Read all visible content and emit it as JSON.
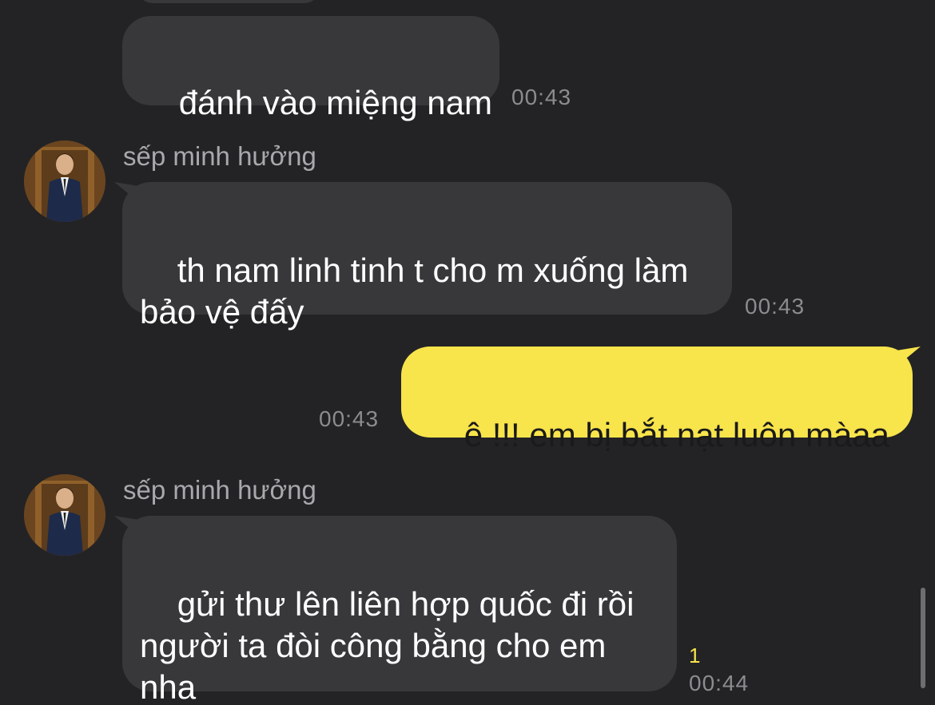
{
  "messages": [
    {
      "text": "đánh vào miệng nam",
      "time": "00:43"
    },
    {
      "sender": "sếp minh hưởng",
      "text": "th nam linh tinh t cho m xuống làm\nbảo vệ đấy",
      "time": "00:43"
    },
    {
      "text": "ê !!! em bị bắt nạt luôn màaa",
      "time": "00:43",
      "mine": true
    },
    {
      "sender": "sếp minh hưởng",
      "text": "gửi thư lên liên hợp quốc đi rồi\nngười ta đòi công bằng cho em\nnha",
      "time": "00:44",
      "unread": "1"
    }
  ],
  "colors": {
    "background": "#232325",
    "bubble_incoming": "#38383b",
    "bubble_outgoing": "#f8e44b",
    "timestamp": "#8c8c90",
    "sender_name": "#a8a8ad",
    "unread_count": "#f8e44b"
  }
}
